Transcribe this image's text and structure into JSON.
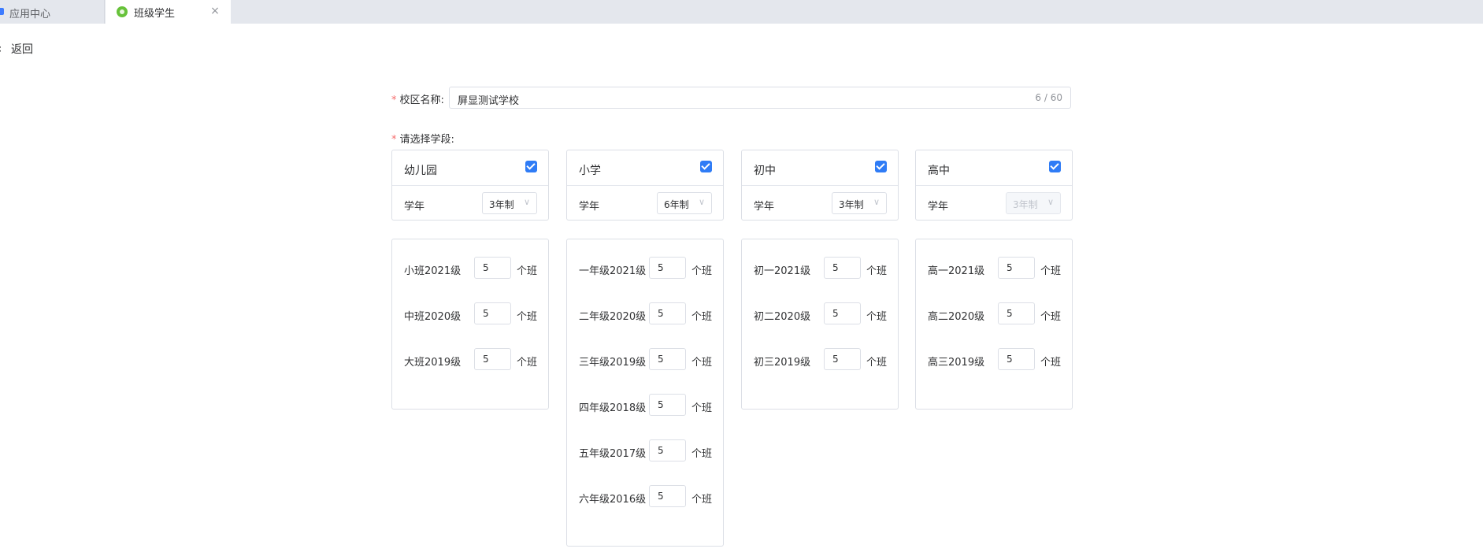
{
  "tabs": [
    {
      "label": "应用中心"
    },
    {
      "label": "班级学生",
      "close": "×"
    }
  ],
  "back": {
    "icon": "‹",
    "label": "返回"
  },
  "form": {
    "required_mark": "*",
    "campus_label": "校区名称:",
    "campus_value": "屏显测试学校",
    "campus_count": "6 / 60",
    "stage_label": "请选择学段:"
  },
  "stages": [
    {
      "name": "幼儿园",
      "checked": true,
      "year_label": "学年",
      "year_value": "3年制",
      "disabled": false,
      "grades": [
        {
          "name": "小班2021级",
          "value": "5",
          "unit": "个班"
        },
        {
          "name": "中班2020级",
          "value": "5",
          "unit": "个班"
        },
        {
          "name": "大班2019级",
          "value": "5",
          "unit": "个班"
        }
      ]
    },
    {
      "name": "小学",
      "checked": true,
      "year_label": "学年",
      "year_value": "6年制",
      "disabled": false,
      "grades": [
        {
          "name": "一年级2021级",
          "value": "5",
          "unit": "个班"
        },
        {
          "name": "二年级2020级",
          "value": "5",
          "unit": "个班"
        },
        {
          "name": "三年级2019级",
          "value": "5",
          "unit": "个班"
        },
        {
          "name": "四年级2018级",
          "value": "5",
          "unit": "个班"
        },
        {
          "name": "五年级2017级",
          "value": "5",
          "unit": "个班"
        },
        {
          "name": "六年级2016级",
          "value": "5",
          "unit": "个班"
        }
      ]
    },
    {
      "name": "初中",
      "checked": true,
      "year_label": "学年",
      "year_value": "3年制",
      "disabled": false,
      "grades": [
        {
          "name": "初一2021级",
          "value": "5",
          "unit": "个班"
        },
        {
          "name": "初二2020级",
          "value": "5",
          "unit": "个班"
        },
        {
          "name": "初三2019级",
          "value": "5",
          "unit": "个班"
        }
      ]
    },
    {
      "name": "高中",
      "checked": true,
      "year_label": "学年",
      "year_value": "3年制",
      "disabled": true,
      "grades": [
        {
          "name": "高一2021级",
          "value": "5",
          "unit": "个班"
        },
        {
          "name": "高二2020级",
          "value": "5",
          "unit": "个班"
        },
        {
          "name": "高三2019级",
          "value": "5",
          "unit": "个班"
        }
      ]
    }
  ],
  "colors": {
    "accent": "#2f7cf6",
    "required": "#f56c6c",
    "border": "#dcdfe6"
  }
}
